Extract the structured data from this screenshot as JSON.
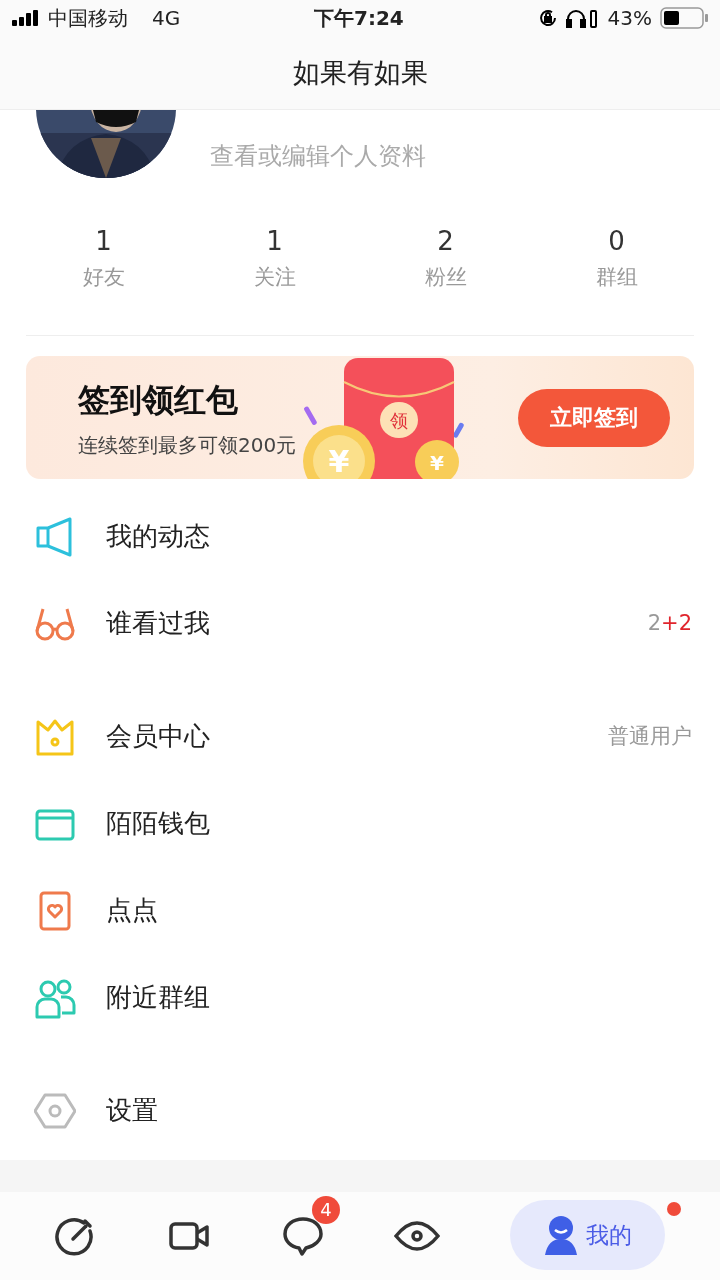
{
  "status_bar": {
    "carrier": "中国移动",
    "network": "4G",
    "time": "下午7:24",
    "battery": "43%"
  },
  "header": {
    "title": "如果有如果"
  },
  "profile": {
    "subtitle": "查看或编辑个人资料"
  },
  "stats": [
    {
      "value": "1",
      "label": "好友"
    },
    {
      "value": "1",
      "label": "关注"
    },
    {
      "value": "2",
      "label": "粉丝"
    },
    {
      "value": "0",
      "label": "群组"
    }
  ],
  "banner": {
    "title": "签到领红包",
    "subtitle": "连续签到最多可领200元",
    "envelope_label": "领",
    "coin_marks": [
      "¥",
      "¥"
    ],
    "button": "立即签到"
  },
  "menu_groups": [
    [
      {
        "label": "我的动态"
      },
      {
        "label": "谁看过我",
        "value": "2",
        "increase": "+2"
      }
    ],
    [
      {
        "label": "会员中心",
        "value": "普通用户"
      },
      {
        "label": "陌陌钱包"
      },
      {
        "label": "点点"
      },
      {
        "label": "附近群组"
      }
    ],
    [
      {
        "label": "设置"
      }
    ]
  ],
  "tabs": [
    {
      "selected": false
    },
    {
      "selected": false
    },
    {
      "selected": false,
      "badge": "4"
    },
    {
      "selected": false
    },
    {
      "selected": true,
      "label": "我的",
      "dot": true
    }
  ]
}
